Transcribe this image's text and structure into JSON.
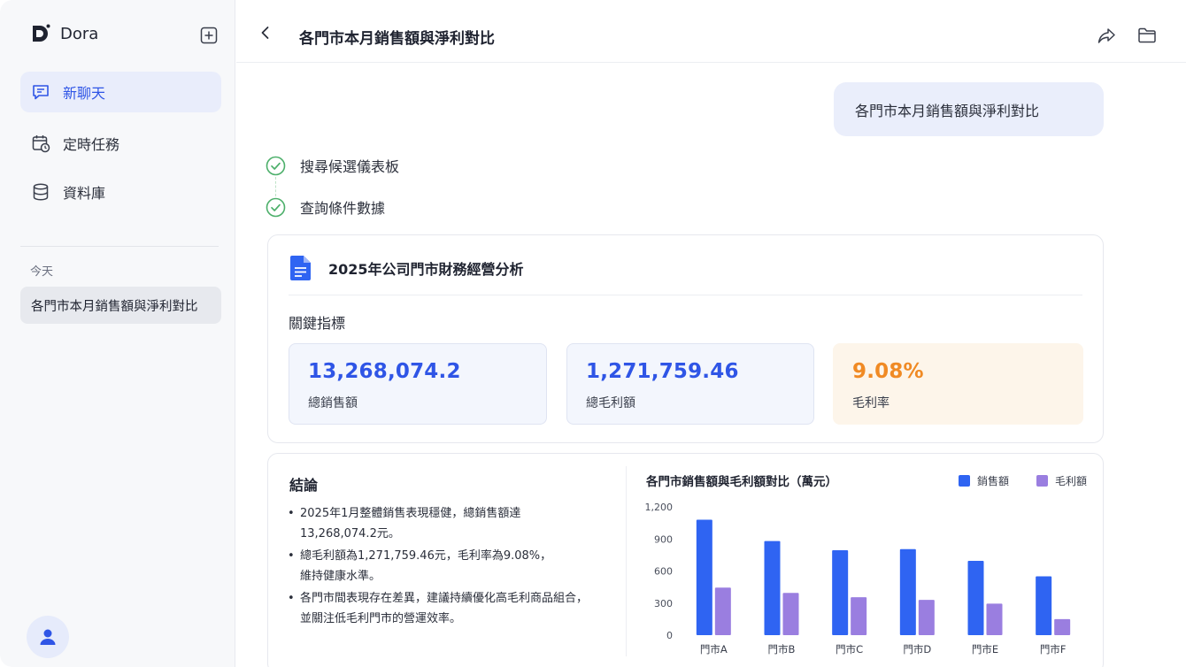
{
  "sidebar": {
    "brand": "Dora",
    "nav": [
      {
        "label": "新聊天"
      },
      {
        "label": "定時任務"
      },
      {
        "label": "資料庫"
      }
    ],
    "section_label": "今天",
    "history": [
      {
        "label": "各門市本月銷售額與淨利對比"
      }
    ]
  },
  "header": {
    "title": "各門市本月銷售額與淨利對比"
  },
  "chat": {
    "user_message": "各門市本月銷售額與淨利對比",
    "steps": [
      {
        "label": "搜尋候選儀表板",
        "status": "done"
      },
      {
        "label": "查詢條件數據",
        "status": "done"
      }
    ]
  },
  "report": {
    "title": "2025年公司門市財務經營分析",
    "kpi_heading": "關鍵指標",
    "kpis": [
      {
        "value": "13,268,074.2",
        "label": "總銷售額"
      },
      {
        "value": "1,271,759.46",
        "label": "總毛利額"
      },
      {
        "value": "9.08%",
        "label": "毛利率"
      }
    ],
    "conclusion_title": "結論",
    "conclusions": [
      {
        "l1": "2025年1月整體銷售表現穩健，總銷售額達",
        "l2": "13,268,074.2元。"
      },
      {
        "l1": "總毛利額為1,271,759.46元，毛利率為9.08%，",
        "l2": "維持健康水準。"
      },
      {
        "l1": "各門市間表現存在差異，建議持續優化高毛利商品組合，",
        "l2": "並關注低毛利門市的營運效率。"
      }
    ]
  },
  "colors": {
    "accent": "#2f55e6",
    "sales_bar": "#2f64f2",
    "profit_bar": "#9a7ee0",
    "warm": "#f08a24",
    "success": "#4caf6a"
  },
  "chart_data": {
    "type": "bar",
    "title": "各門市銷售額與毛利額對比（萬元）",
    "categories": [
      "門市A",
      "門市B",
      "門市C",
      "門市D",
      "門市E",
      "門市F"
    ],
    "series": [
      {
        "name": "銷售額",
        "values": [
          1080,
          880,
          795,
          805,
          695,
          550
        ]
      },
      {
        "name": "毛利額",
        "values": [
          445,
          395,
          355,
          330,
          295,
          150
        ]
      }
    ],
    "ylim": [
      0,
      1200
    ],
    "yticks": [
      "0",
      "300",
      "600",
      "900",
      "1,200"
    ],
    "legend": "top-right",
    "grid": false
  }
}
